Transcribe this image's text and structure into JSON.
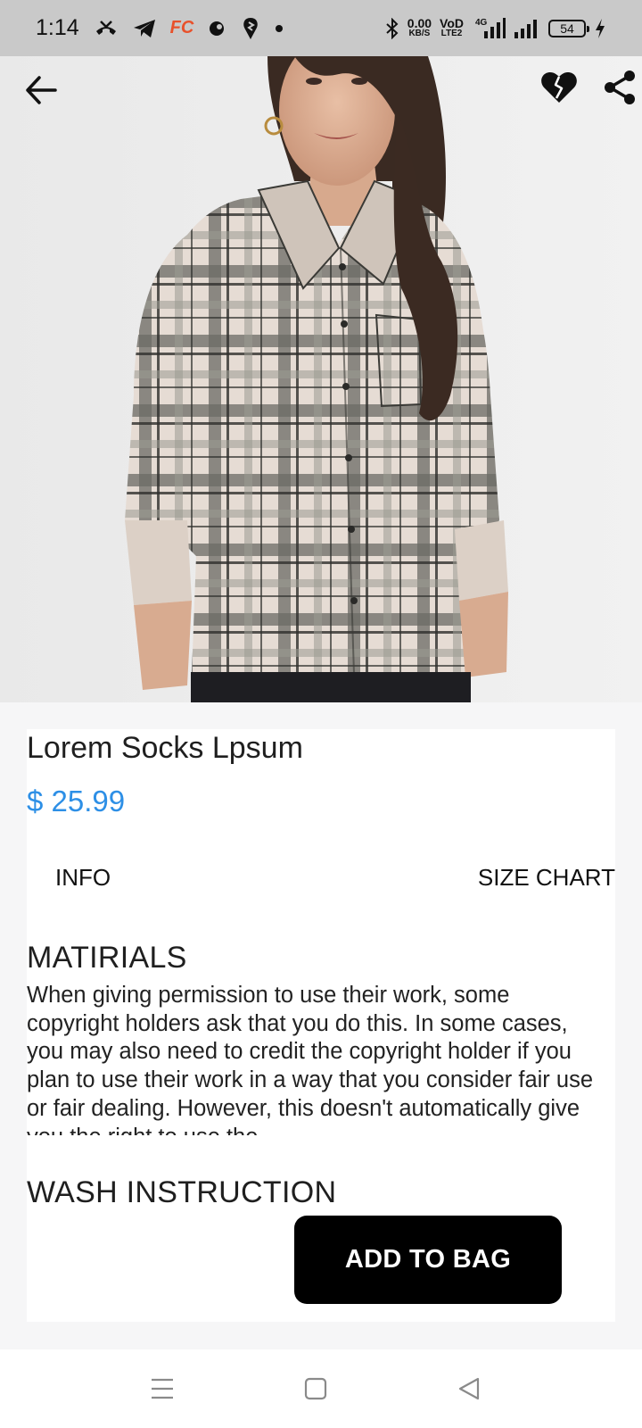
{
  "status_bar": {
    "time": "1:14",
    "fc_badge": "FC",
    "net_speed": "0.00",
    "net_speed_unit": "KB/S",
    "volte_top": "VoD",
    "volte_bottom": "LTE2",
    "network_type": "4G",
    "battery_level": "54",
    "icons": [
      "missed-call-icon",
      "telegram-icon",
      "fc-app-icon",
      "notification-icon",
      "swiggy-icon",
      "dot-icon",
      "bluetooth-icon",
      "signal-icon",
      "signal-icon",
      "battery-icon",
      "charging-icon"
    ]
  },
  "header": {
    "back_icon": "arrow-left-icon",
    "wishlist_icon": "broken-heart-icon",
    "share_icon": "share-icon"
  },
  "product": {
    "image": "model-wearing-plaid-shirt",
    "title": "Lorem Socks Lpsum",
    "price": "$ 25.99",
    "price_color": "#2d8fe6"
  },
  "tabs": [
    {
      "label": "INFO"
    },
    {
      "label": "SIZE CHART"
    }
  ],
  "sections": {
    "materials_title": "MATIRIALS",
    "materials_text": "When giving permission to use their work, some copyright holders ask that you do this. In some cases, you may also need to credit the copyright holder if you plan to use their work in a way that you consider fair use or fair dealing. However, this doesn't automatically give you the right to use the",
    "wash_title": "WASH INSTRUCTION"
  },
  "actions": {
    "add_to_bag": "ADD TO BAG"
  },
  "nav_bar": {
    "icons": [
      "menu-icon",
      "home-square-icon",
      "back-triangle-icon"
    ]
  }
}
